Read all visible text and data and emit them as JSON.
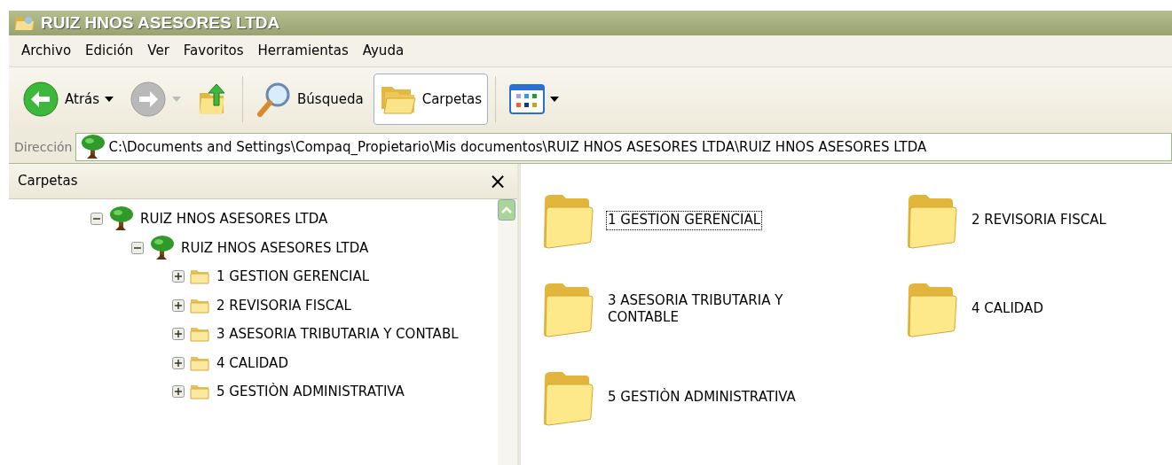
{
  "window": {
    "title": "RUIZ HNOS ASESORES LTDA"
  },
  "menu": [
    "Archivo",
    "Edición",
    "Ver",
    "Favoritos",
    "Herramientas",
    "Ayuda"
  ],
  "toolbar": [
    {
      "kind": "back",
      "label": "Atrás",
      "disabled": false,
      "selected": false
    },
    {
      "kind": "forward",
      "disabled": true,
      "selected": false
    },
    {
      "kind": "up",
      "disabled": false,
      "selected": false
    },
    {
      "kind": "search",
      "label": "Búsqueda",
      "disabled": false,
      "selected": false
    },
    {
      "kind": "folders",
      "label": "Carpetas",
      "disabled": false,
      "selected": true
    },
    {
      "kind": "views",
      "disabled": false,
      "selected": false
    }
  ],
  "address": {
    "label": "Dirección",
    "value": "C:\\Documents and Settings\\Compaq_Propietario\\Mis documentos\\RUIZ HNOS ASESORES LTDA\\RUIZ HNOS ASESORES LTDA"
  },
  "folders_pane": {
    "title": "Carpetas",
    "close": "×",
    "tree": [
      {
        "label": "RUIZ HNOS ASESORES LTDA",
        "kind": "tree",
        "expanded": true,
        "children": [
          {
            "label": "RUIZ HNOS ASESORES LTDA",
            "kind": "tree",
            "expanded": true,
            "children": [
              {
                "label": "1 GESTION GERENCIAL",
                "kind": "folder",
                "expanded": false
              },
              {
                "label": "2 REVISORIA FISCAL",
                "kind": "folder",
                "expanded": false
              },
              {
                "label": "3 ASESORIA TRIBUTARIA Y CONTABL",
                "kind": "folder",
                "expanded": false
              },
              {
                "label": "4 CALIDAD",
                "kind": "folder",
                "expanded": false
              },
              {
                "label": "5 GESTIÒN ADMINISTRATIVA",
                "kind": "folder",
                "expanded": false
              }
            ]
          }
        ]
      }
    ]
  },
  "content": [
    {
      "label": "1 GESTION GERENCIAL",
      "selected": true
    },
    {
      "label": "2 REVISORIA FISCAL",
      "selected": false
    },
    {
      "label": "3 ASESORIA TRIBUTARIA Y CONTABLE",
      "selected": false
    },
    {
      "label": "4 CALIDAD",
      "selected": false
    },
    {
      "label": "5 GESTIÒN ADMINISTRATIVA",
      "selected": false
    }
  ]
}
